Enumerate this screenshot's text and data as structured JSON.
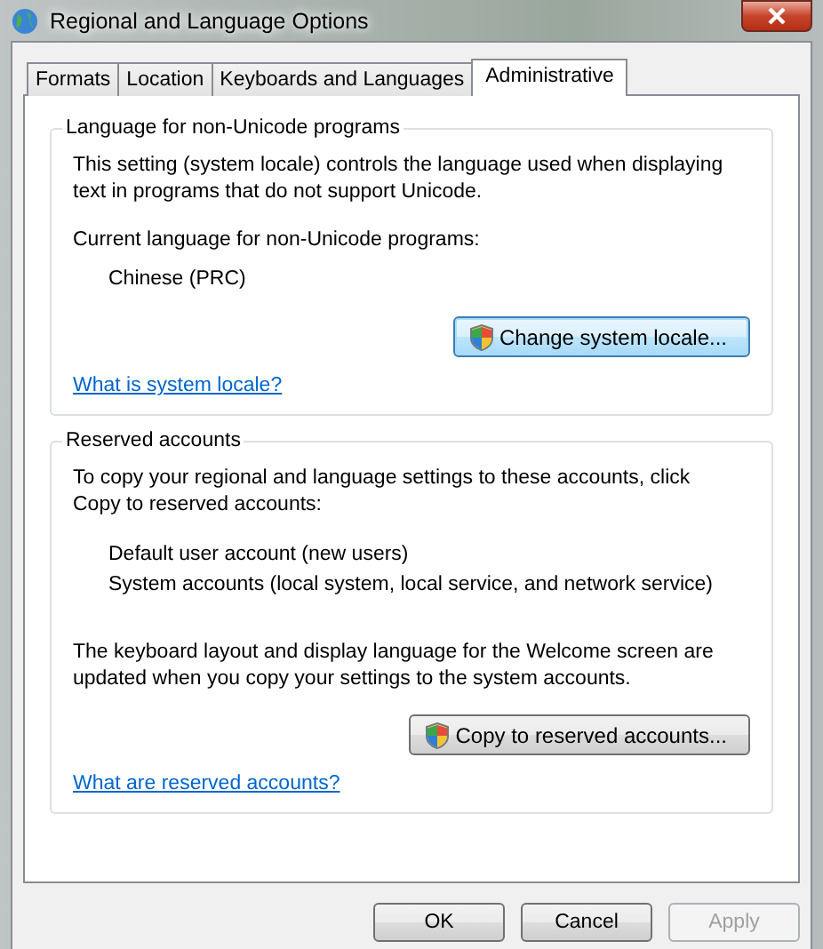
{
  "window": {
    "title": "Regional and Language Options"
  },
  "tabs": [
    {
      "label": "Formats",
      "selected": false
    },
    {
      "label": "Location",
      "selected": false
    },
    {
      "label": "Keyboards and Languages",
      "selected": false
    },
    {
      "label": "Administrative",
      "selected": true
    }
  ],
  "groups": [
    {
      "title": "Language for non-Unicode programs",
      "description": "This setting (system locale) controls the language used when displaying text in programs that do not support Unicode.",
      "label": "Current language for non-Unicode programs:",
      "items": [
        "Chinese (PRC)"
      ],
      "button": {
        "label": "Change system locale...",
        "focused": true
      },
      "link": "What is system locale?"
    },
    {
      "title": "Reserved accounts",
      "description": "To copy your regional and language settings to these accounts, click Copy to reserved accounts:",
      "items": [
        "Default user account (new users)",
        "System accounts (local system, local service, and network service)"
      ],
      "note": "The keyboard layout and display language for the Welcome screen are updated when you copy your settings to the system accounts.",
      "button": {
        "label": "Copy to reserved accounts...",
        "focused": false
      },
      "link": "What are reserved accounts?"
    }
  ],
  "buttons": [
    {
      "label": "OK",
      "disabled": false
    },
    {
      "label": "Cancel",
      "disabled": false
    },
    {
      "label": "Apply",
      "disabled": true
    }
  ]
}
